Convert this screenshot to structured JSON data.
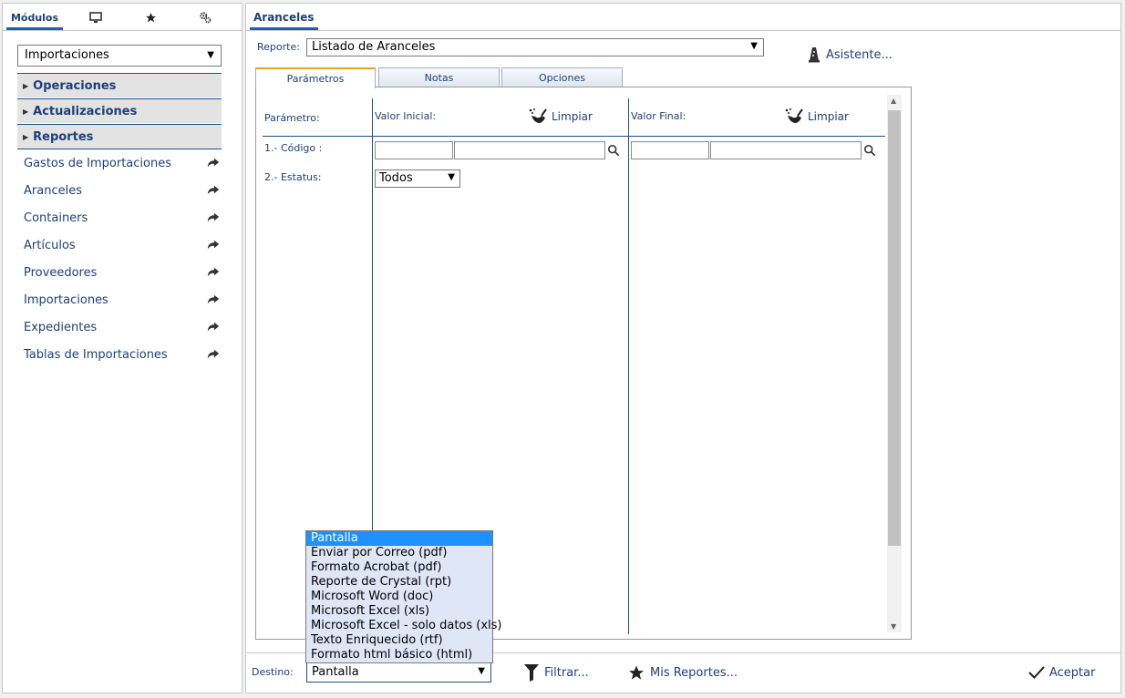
{
  "left_tabs": {
    "modulos": "Módulos",
    "monitor_icon": "monitor-icon",
    "star_icon": "star-icon",
    "gear_icon": "gear-icon"
  },
  "module_select": {
    "value": "Importaciones"
  },
  "sections": {
    "operaciones": "Operaciones",
    "actualizaciones": "Actualizaciones",
    "reportes": "Reportes"
  },
  "nav_items": [
    "Gastos de Importaciones",
    "Aranceles",
    "Containers",
    "Artículos",
    "Proveedores",
    "Importaciones",
    "Expedientes",
    "Tablas de Importaciones"
  ],
  "right": {
    "tab_title": "Aranceles",
    "reporte_label": "Reporte:",
    "reporte_value": "Listado de Aranceles",
    "asistente_label": "Asistente...",
    "tabs": [
      "Parámetros",
      "Notas",
      "Opciones"
    ]
  },
  "params": {
    "col_parametro": "Parámetro:",
    "col_valor_inicial": "Valor Inicial:",
    "col_valor_final": "Valor Final:",
    "limpiar": "Limpiar",
    "row1_label": "1.- Código :",
    "row2_label": "2.- Estatus:",
    "estatus_value": "Todos"
  },
  "bottom": {
    "destino_label": "Destino:",
    "destino_value": "Pantalla",
    "filtrar": "Filtrar...",
    "mis_reportes": "Mis Reportes...",
    "aceptar": "Aceptar"
  },
  "destino_options": [
    "Pantalla",
    "Enviar por Correo (pdf)",
    "Formato Acrobat (pdf)",
    "Reporte de Crystal (rpt)",
    "Microsoft Word (doc)",
    "Microsoft Excel (xls)",
    "Microsoft Excel - solo datos (xls)",
    "Texto Enriquecido (rtf)",
    "Formato html básico (html)"
  ],
  "colors": {
    "accent": "#1f3f7a",
    "active_tab": "#f0a020",
    "selected_option": "#1e90ff"
  }
}
